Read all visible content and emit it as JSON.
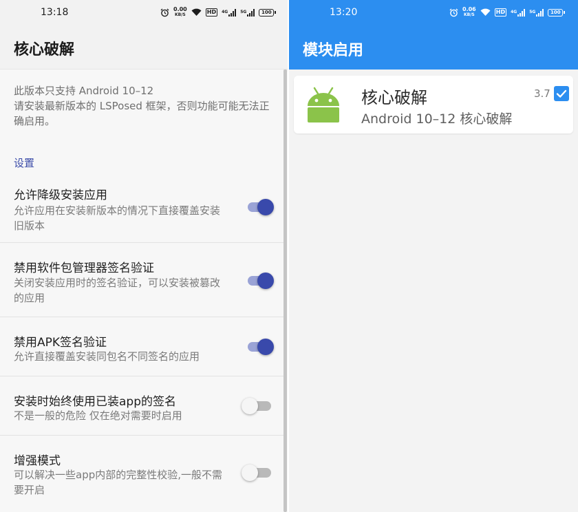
{
  "left": {
    "status": {
      "time": "13:18",
      "net_speed": "0.00",
      "net_unit": "KB/S",
      "hd": "HD",
      "sig1": "4G",
      "sig2": "5G",
      "battery": "100"
    },
    "title": "核心破解",
    "note": "此版本只支持 Android 10–12\n请安装最新版本的 LSPosed 框架，否则功能可能无法正确启用。",
    "section": "设置",
    "prefs": [
      {
        "title": "允许降级安装应用",
        "summary": "允许应用在安装新版本的情况下直接覆盖安装旧版本",
        "enabled": true
      },
      {
        "title": "禁用软件包管理器签名验证",
        "summary": "关闭安装应用时的签名验证，可以安装被篡改的应用",
        "enabled": true
      },
      {
        "title": "禁用APK签名验证",
        "summary": "允许直接覆盖安装同包名不同签名的应用",
        "enabled": true
      },
      {
        "title": "安装时始终使用已装app的签名",
        "summary": "不是一般的危险 仅在绝对需要时启用",
        "enabled": false
      },
      {
        "title": "增强模式",
        "summary": "可以解决一些app内部的完整性校验,一般不需要开启",
        "enabled": false
      }
    ]
  },
  "right": {
    "status": {
      "time": "13:20",
      "net_speed": "0.06",
      "net_unit": "KB/S",
      "hd": "HD",
      "sig1": "4G",
      "sig2": "5G",
      "battery": "100"
    },
    "title": "模块启用",
    "module": {
      "name": "核心破解",
      "description": "Android 10–12 核心破解",
      "version": "3.7",
      "checked": true,
      "icon": "android-robot-icon"
    }
  },
  "colors": {
    "accent_left": "#3949ab",
    "accent_right": "#2c8ef0"
  }
}
